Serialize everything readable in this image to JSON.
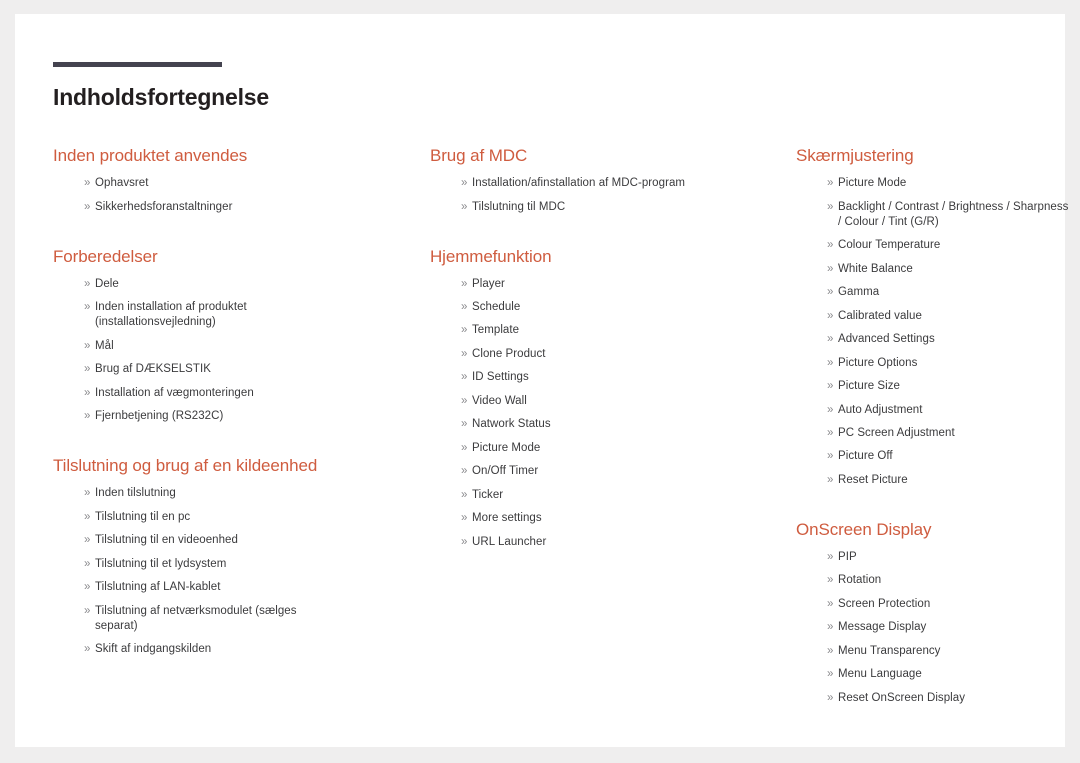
{
  "page": {
    "title": "Indholdsfortegnelse",
    "bullet_glyph": "»",
    "colors": {
      "heading_orange": "#cf5c3f",
      "title_dark": "#231f20",
      "rule_dark": "#44434f",
      "body_text": "#3b3b3d",
      "bullet_gray": "#8b8b8e",
      "sheet_white": "#ffffff",
      "page_background": "#efeeee"
    }
  },
  "columns": [
    {
      "name": "column-left",
      "sections": [
        {
          "heading": "Inden produktet anvendes",
          "items": [
            {
              "lines": [
                "Ophavsret"
              ]
            },
            {
              "lines": [
                "Sikkerhedsforanstaltninger"
              ]
            }
          ]
        },
        {
          "heading": "Forberedelser",
          "items": [
            {
              "lines": [
                "Dele"
              ]
            },
            {
              "lines": [
                "Inden installation af produktet",
                "(installationsvejledning)"
              ]
            },
            {
              "lines": [
                "Mål"
              ]
            },
            {
              "lines": [
                "Brug af DÆKSELSTIK"
              ]
            },
            {
              "lines": [
                "Installation af vægmonteringen"
              ]
            },
            {
              "lines": [
                "Fjernbetjening (RS232C)"
              ]
            }
          ]
        },
        {
          "heading": "Tilslutning og brug af en kildeenhed",
          "items": [
            {
              "lines": [
                "Inden tilslutning"
              ]
            },
            {
              "lines": [
                "Tilslutning til en pc"
              ]
            },
            {
              "lines": [
                "Tilslutning til en videoenhed"
              ]
            },
            {
              "lines": [
                "Tilslutning til et lydsystem"
              ]
            },
            {
              "lines": [
                "Tilslutning af LAN-kablet"
              ]
            },
            {
              "lines": [
                "Tilslutning af netværksmodulet (sælges",
                "separat)"
              ]
            },
            {
              "lines": [
                "Skift af indgangskilden"
              ]
            }
          ]
        }
      ]
    },
    {
      "name": "column-middle",
      "sections": [
        {
          "heading": "Brug af MDC",
          "items": [
            {
              "lines": [
                "Installation/afinstallation af MDC-program"
              ]
            },
            {
              "lines": [
                "Tilslutning til MDC"
              ]
            }
          ]
        },
        {
          "heading": "Hjemmefunktion",
          "items": [
            {
              "lines": [
                "Player"
              ]
            },
            {
              "lines": [
                "Schedule"
              ]
            },
            {
              "lines": [
                "Template"
              ]
            },
            {
              "lines": [
                "Clone Product"
              ]
            },
            {
              "lines": [
                "ID Settings"
              ]
            },
            {
              "lines": [
                "Video Wall"
              ]
            },
            {
              "lines": [
                "Natwork Status"
              ]
            },
            {
              "lines": [
                "Picture Mode"
              ]
            },
            {
              "lines": [
                "On/Off Timer"
              ]
            },
            {
              "lines": [
                "Ticker"
              ]
            },
            {
              "lines": [
                "More settings"
              ]
            },
            {
              "lines": [
                "URL Launcher"
              ]
            }
          ]
        }
      ]
    },
    {
      "name": "column-right",
      "sections": [
        {
          "heading": "Skærmjustering",
          "items": [
            {
              "lines": [
                "Picture Mode"
              ]
            },
            {
              "lines": [
                "Backlight / Contrast / Brightness / Sharpness",
                "/ Colour / Tint (G/R)"
              ]
            },
            {
              "lines": [
                "Colour Temperature"
              ]
            },
            {
              "lines": [
                "White Balance"
              ]
            },
            {
              "lines": [
                "Gamma"
              ]
            },
            {
              "lines": [
                "Calibrated value"
              ]
            },
            {
              "lines": [
                "Advanced Settings"
              ]
            },
            {
              "lines": [
                "Picture Options"
              ]
            },
            {
              "lines": [
                "Picture Size"
              ]
            },
            {
              "lines": [
                "Auto Adjustment"
              ]
            },
            {
              "lines": [
                "PC Screen Adjustment"
              ]
            },
            {
              "lines": [
                "Picture Off"
              ]
            },
            {
              "lines": [
                "Reset Picture"
              ]
            }
          ]
        },
        {
          "heading": "OnScreen Display",
          "items": [
            {
              "lines": [
                "PIP"
              ]
            },
            {
              "lines": [
                "Rotation"
              ]
            },
            {
              "lines": [
                "Screen Protection"
              ]
            },
            {
              "lines": [
                "Message Display"
              ]
            },
            {
              "lines": [
                "Menu Transparency"
              ]
            },
            {
              "lines": [
                "Menu Language"
              ]
            },
            {
              "lines": [
                "Reset OnScreen Display"
              ]
            }
          ]
        }
      ]
    }
  ]
}
